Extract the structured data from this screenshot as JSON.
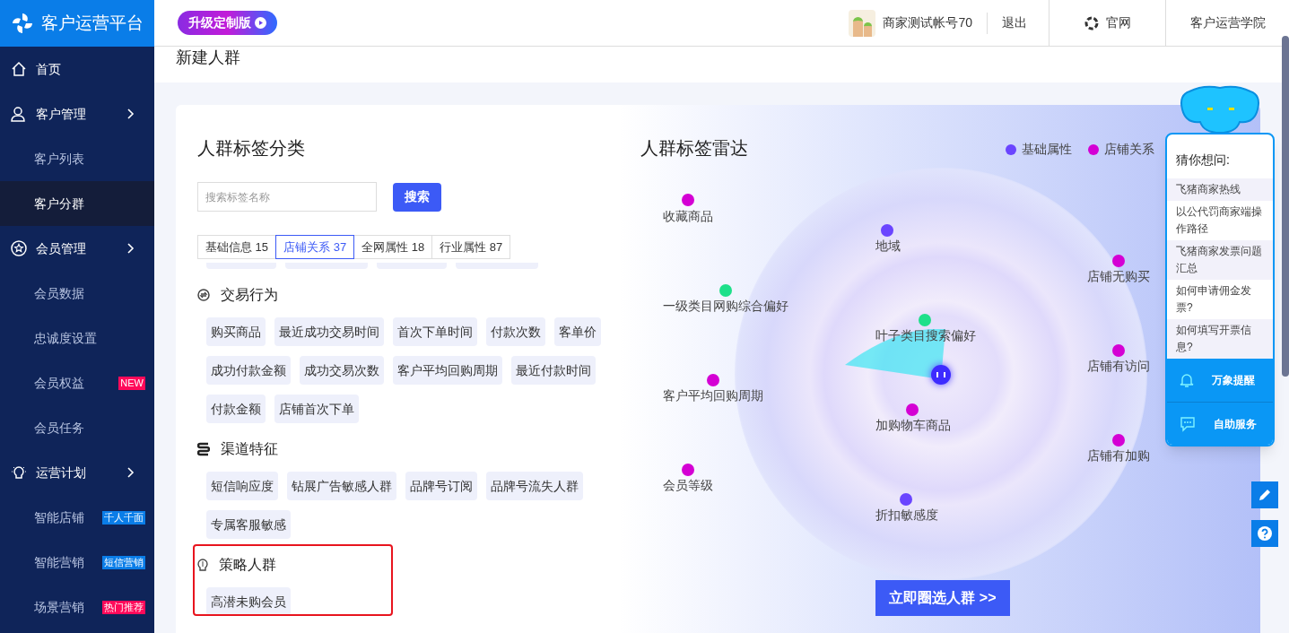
{
  "app": {
    "title": "客户运营平台",
    "upgrade": "升级定制版"
  },
  "header": {
    "account": "商家测试帐号70",
    "logout": "退出",
    "site": "官网",
    "academy": "客户运营学院"
  },
  "sidebar": {
    "items": [
      {
        "label": "首页"
      },
      {
        "label": "客户管理",
        "children": [
          {
            "label": "客户列表",
            "selected": false
          },
          {
            "label": "客户分群",
            "selected": true
          }
        ]
      },
      {
        "label": "会员管理",
        "children": [
          {
            "label": "会员数据",
            "selected": false
          },
          {
            "label": "忠诚度设置",
            "selected": false
          },
          {
            "label": "会员权益",
            "selected": false,
            "badge": "NEW",
            "color": "#ff0a5a"
          },
          {
            "label": "会员任务",
            "selected": false
          }
        ]
      },
      {
        "label": "运营计划",
        "children": [
          {
            "label": "智能店铺",
            "selected": false,
            "badge": "千人千面",
            "color": "#0a7de8"
          },
          {
            "label": "智能营销",
            "selected": false,
            "badge": "短信营销",
            "color": "#0a7de8"
          },
          {
            "label": "场景营销",
            "selected": false,
            "badge": "热门推荐",
            "color": "#ff0a5a"
          }
        ]
      }
    ]
  },
  "page": {
    "title": "新建人群"
  },
  "categories": {
    "title": "人群标签分类",
    "search": {
      "placeholder": "搜索标签名称",
      "button": "搜索"
    },
    "tabs": [
      {
        "label": "基础信息 15",
        "selected": false
      },
      {
        "label": "店铺关系 37",
        "selected": true
      },
      {
        "label": "全网属性 18",
        "selected": false
      },
      {
        "label": "行业属性 87",
        "selected": false
      }
    ],
    "sections": [
      {
        "title": "交易行为",
        "highlighted": false,
        "tags": [
          "购买商品",
          "最近成功交易时间",
          "首次下单时间",
          "付款次数",
          "客单价",
          "成功付款金额",
          "成功交易次数",
          "客户平均回购周期",
          "最近付款时间",
          "付款金额",
          "店铺首次下单"
        ]
      },
      {
        "title": "渠道特征",
        "highlighted": false,
        "tags": [
          "短信响应度",
          "钻展广告敏感人群",
          "品牌号订阅",
          "品牌号流失人群",
          "专属客服敏感"
        ]
      },
      {
        "title": "策略人群",
        "highlighted": true,
        "tags": [
          "高潜未购会员"
        ]
      }
    ]
  },
  "radar": {
    "title": "人群标签雷达",
    "legend": [
      {
        "label": "基础属性",
        "color": "#6a45ff"
      },
      {
        "label": "店铺关系",
        "color": "#d400d4"
      }
    ],
    "points": [
      {
        "label": "收藏商品",
        "color": "#d400d4"
      },
      {
        "label": "地域",
        "color": "#6a45ff"
      },
      {
        "label": "店铺无购买",
        "color": "#d400d4"
      },
      {
        "label": "一级类目网购综合偏好",
        "color": "#1ee08a"
      },
      {
        "label": "叶子类目搜索偏好",
        "color": "#1ee08a"
      },
      {
        "label": "店铺有访问",
        "color": "#d400d4"
      },
      {
        "label": "客户平均回购周期",
        "color": "#d400d4"
      },
      {
        "label": "加购物车商品",
        "color": "#d400d4"
      },
      {
        "label": "店铺有加购",
        "color": "#d400d4"
      },
      {
        "label": "会员等级",
        "color": "#d400d4"
      },
      {
        "label": "折扣敏感度",
        "color": "#6a45ff"
      }
    ],
    "button": "立即圈选人群 >>"
  },
  "helper": {
    "title": "猜你想问:",
    "questions": [
      "飞猪商家热线",
      "以公代罚商家端操作路径",
      "飞猪商家发票问题汇总",
      "如何申请佣金发票?",
      "如何填写开票信息?"
    ],
    "actions": [
      "万象提醒",
      "自助服务"
    ]
  }
}
